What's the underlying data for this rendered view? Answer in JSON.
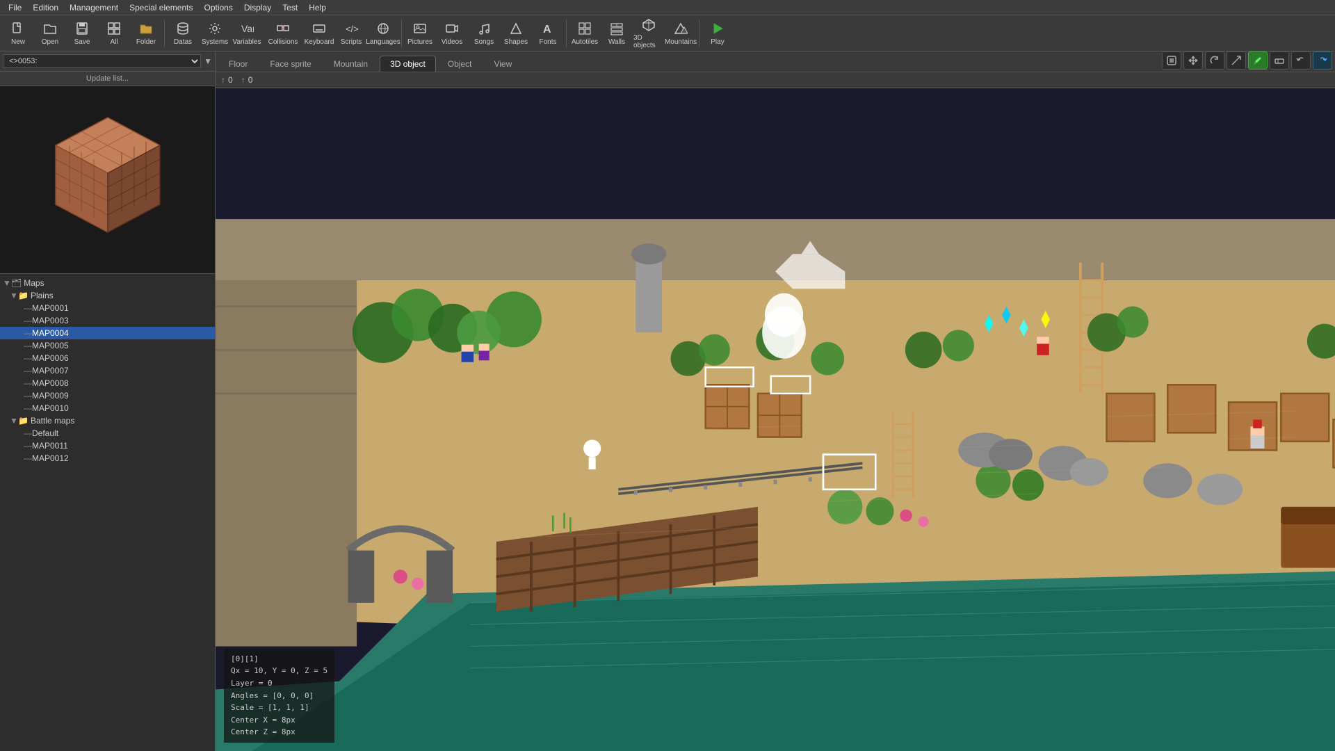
{
  "menubar": {
    "items": [
      "File",
      "Edition",
      "Management",
      "Special elements",
      "Options",
      "Display",
      "Test",
      "Help"
    ]
  },
  "toolbar": {
    "buttons": [
      {
        "name": "new-button",
        "label": "New",
        "icon": "📄"
      },
      {
        "name": "open-button",
        "label": "Open",
        "icon": "📂"
      },
      {
        "name": "save-button",
        "label": "Save",
        "icon": "💾"
      },
      {
        "name": "all-button",
        "label": "All",
        "icon": "📋"
      },
      {
        "name": "folder-button",
        "label": "Folder",
        "icon": "📁"
      },
      {
        "name": "datas-button",
        "label": "Datas",
        "icon": "🗄"
      },
      {
        "name": "systems-button",
        "label": "Systems",
        "icon": "⚙"
      },
      {
        "name": "variables-button",
        "label": "Variables",
        "icon": "📊"
      },
      {
        "name": "collisions-button",
        "label": "Collisions",
        "icon": "💥"
      },
      {
        "name": "keyboard-button",
        "label": "Keyboard",
        "icon": "⌨"
      },
      {
        "name": "scripts-button",
        "label": "Scripts",
        "icon": "📝"
      },
      {
        "name": "languages-button",
        "label": "Languages",
        "icon": "🌐"
      },
      {
        "name": "pictures-button",
        "label": "Pictures",
        "icon": "🖼"
      },
      {
        "name": "videos-button",
        "label": "Videos",
        "icon": "🎬"
      },
      {
        "name": "songs-button",
        "label": "Songs",
        "icon": "🎵"
      },
      {
        "name": "shapes-button",
        "label": "Shapes",
        "icon": "🔷"
      },
      {
        "name": "fonts-button",
        "label": "Fonts",
        "icon": "🔤"
      },
      {
        "name": "autotiles-button",
        "label": "Autotiles",
        "icon": "🔲"
      },
      {
        "name": "walls-button",
        "label": "Walls",
        "icon": "🧱"
      },
      {
        "name": "3dobjects-button",
        "label": "3D objects",
        "icon": "📦"
      },
      {
        "name": "mountains-button",
        "label": "Mountains",
        "icon": "⛰"
      },
      {
        "name": "play-button",
        "label": "Play",
        "icon": "▶"
      }
    ]
  },
  "left_panel": {
    "map_selector": {
      "value": "<>0053:",
      "placeholder": "<>0053:"
    },
    "update_list_label": "Update list...",
    "tree": {
      "root_label": "Maps",
      "children": [
        {
          "label": "Plains",
          "type": "folder",
          "expanded": true,
          "children": [
            {
              "label": "MAP0001",
              "type": "map"
            },
            {
              "label": "MAP0003",
              "type": "map"
            },
            {
              "label": "MAP0004",
              "type": "map",
              "selected": true
            },
            {
              "label": "MAP0005",
              "type": "map"
            },
            {
              "label": "MAP0006",
              "type": "map"
            },
            {
              "label": "MAP0007",
              "type": "map"
            },
            {
              "label": "MAP0008",
              "type": "map"
            },
            {
              "label": "MAP0009",
              "type": "map"
            },
            {
              "label": "MAP0010",
              "type": "map"
            }
          ]
        },
        {
          "label": "Battle maps",
          "type": "folder",
          "expanded": true,
          "children": [
            {
              "label": "Default",
              "type": "default"
            },
            {
              "label": "MAP0011",
              "type": "map"
            },
            {
              "label": "MAP0012",
              "type": "map"
            }
          ]
        }
      ]
    }
  },
  "tabs": {
    "items": [
      "Floor",
      "Face sprite",
      "Mountain",
      "3D object",
      "Object",
      "View"
    ],
    "active": "3D object"
  },
  "arrows": {
    "row1": {
      "icon": "↑",
      "value": "0"
    },
    "row2": {
      "icon": "↑",
      "value": "0"
    }
  },
  "right_toolbar": {
    "buttons": [
      {
        "name": "select-tool",
        "icon": "⊡",
        "active": false
      },
      {
        "name": "move-tool",
        "icon": "✛",
        "active": false
      },
      {
        "name": "rotate-tool",
        "icon": "↻",
        "active": false
      },
      {
        "name": "scale-tool",
        "icon": "⤡",
        "active": false
      },
      {
        "name": "draw-tool",
        "icon": "✏",
        "active": true
      },
      {
        "name": "erase-tool",
        "icon": "▬",
        "active": false
      },
      {
        "name": "undo-tool",
        "icon": "↩",
        "active": false
      },
      {
        "name": "redo-tool",
        "icon": "↪",
        "active": true
      }
    ]
  },
  "coord_info": {
    "line1": "[0][1]",
    "line2": "Qx = 10, Y = 0, Z = 5",
    "line3": "Layer = 0",
    "line4": "Angles = [0, 0, 0]",
    "line5": "Scale = [1, 1, 1]",
    "line6": "Center X = 8px",
    "line7": "Center Z = 8px"
  }
}
